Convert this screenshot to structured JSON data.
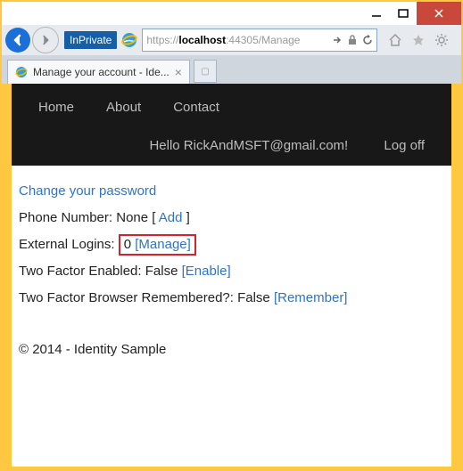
{
  "window": {
    "inprivate_label": "InPrivate",
    "url_scheme": "https://",
    "url_host": "localhost",
    "url_port": ":44305",
    "url_path": "/Manage",
    "tab_title": "Manage your account - Ide..."
  },
  "header": {
    "nav": {
      "home": "Home",
      "about": "About",
      "contact": "Contact"
    },
    "greeting": "Hello RickAndMSFT@gmail.com!",
    "logoff": "Log off"
  },
  "content": {
    "change_pw": "Change your password",
    "phone_label": "Phone Number:",
    "phone_value": "None",
    "phone_add": "Add",
    "ext_label": "External Logins:",
    "ext_count": "0",
    "ext_manage": "[Manage]",
    "twofactor_label": "Two Factor Enabled:",
    "twofactor_value": "False",
    "twofactor_enable": "[Enable]",
    "remember_label": "Two Factor Browser Remembered?:",
    "remember_value": "False",
    "remember_link": "[Remember]"
  },
  "footer": {
    "text": "© 2014 - Identity Sample"
  }
}
